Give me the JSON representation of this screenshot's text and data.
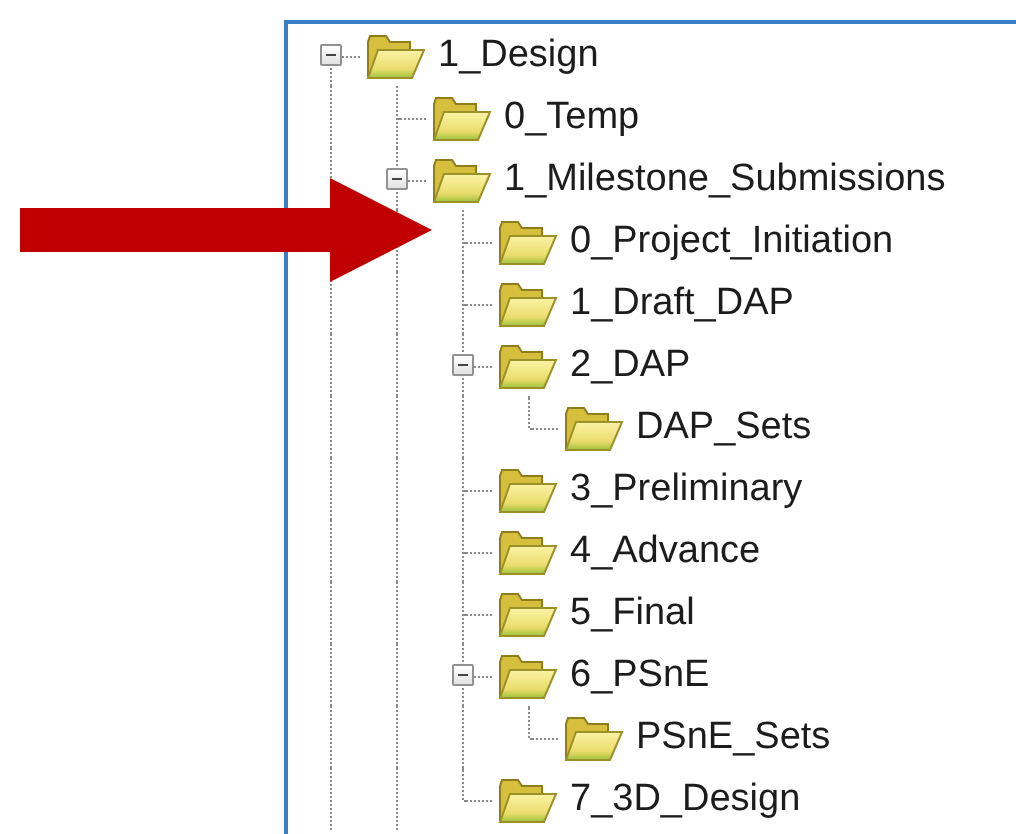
{
  "tree": [
    {
      "label": "1_Design",
      "expanded": true,
      "children": [
        {
          "label": "0_Temp"
        },
        {
          "label": "1_Milestone_Submissions",
          "expanded": true,
          "children": [
            {
              "label": "0_Project_Initiation"
            },
            {
              "label": "1_Draft_DAP"
            },
            {
              "label": "2_DAP",
              "expanded": true,
              "children": [
                {
                  "label": "DAP_Sets"
                }
              ]
            },
            {
              "label": "3_Preliminary"
            },
            {
              "label": "4_Advance"
            },
            {
              "label": "5_Final"
            },
            {
              "label": "6_PSnE",
              "expanded": true,
              "children": [
                {
                  "label": "PSnE_Sets"
                }
              ]
            },
            {
              "label": "7_3D_Design"
            }
          ]
        }
      ]
    }
  ]
}
